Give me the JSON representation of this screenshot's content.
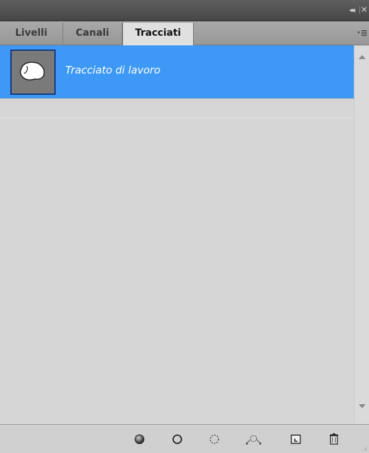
{
  "tabs": [
    {
      "label": "Livelli",
      "active": false
    },
    {
      "label": "Canali",
      "active": false
    },
    {
      "label": "Tracciati",
      "active": true
    }
  ],
  "paths": [
    {
      "label": "Tracciato di lavoro",
      "selected": true
    }
  ],
  "toolbar": {
    "icons": [
      "fill-path-icon",
      "stroke-path-icon",
      "load-selection-icon",
      "make-work-path-icon",
      "new-path-icon",
      "delete-path-icon"
    ]
  },
  "colors": {
    "selection": "#3d99f5",
    "panel_bg": "#d6d6d6",
    "titlebar": "#4f4f4f"
  }
}
